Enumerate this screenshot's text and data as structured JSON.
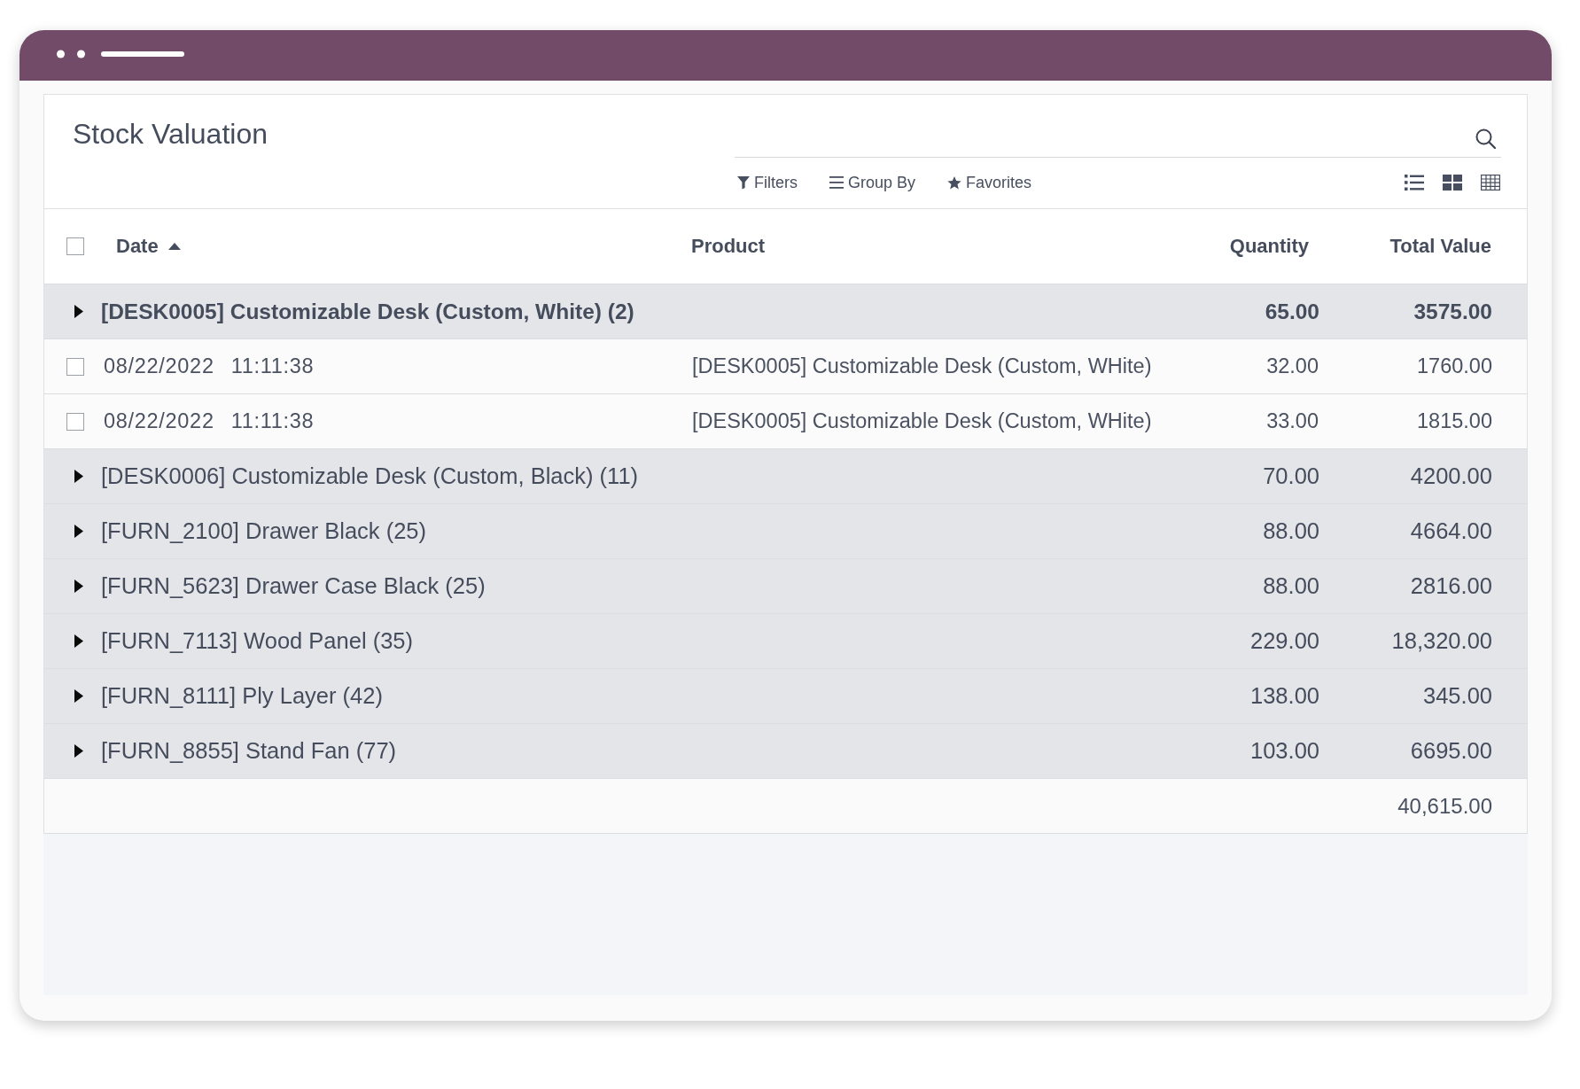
{
  "control_panel": {
    "title": "Stock Valuation",
    "search_menus": [
      {
        "kind": "filter",
        "label": "Filters"
      },
      {
        "kind": "group",
        "label": "Group By"
      },
      {
        "kind": "favorite",
        "label": "Favorites"
      }
    ],
    "views": [
      {
        "kind": "list"
      },
      {
        "kind": "kanban"
      },
      {
        "kind": "grid"
      }
    ]
  },
  "table": {
    "select_all": {
      "checked": false
    },
    "columns": [
      {
        "label": "Date",
        "kind": "date",
        "sorted": true
      },
      {
        "label": "Product",
        "kind": "text",
        "sorted": false
      },
      {
        "label": "Quantity",
        "kind": "number",
        "sorted": false
      },
      {
        "label": "Total Value",
        "kind": "number",
        "sorted": false
      }
    ],
    "groups": [
      {
        "label": "[DESK0005] Customizable Desk (Custom, White) (2)",
        "quantity": "65.00",
        "total_value": "3575.00",
        "expanded": true,
        "rows": [
          {
            "checked": false,
            "date": "08/22/2022 11:11:38",
            "product": "[DESK0005] Customizable Desk (Custom, WHite)",
            "quantity": "32.00",
            "total_value": "1760.00"
          },
          {
            "checked": false,
            "date": "08/22/2022 11:11:38",
            "product": "[DESK0005] Customizable Desk (Custom, WHite)",
            "quantity": "33.00",
            "total_value": "1815.00"
          }
        ]
      },
      {
        "label": "[DESK0006] Customizable Desk (Custom, Black) (11)",
        "quantity": "70.00",
        "total_value": "4200.00",
        "expanded": false
      },
      {
        "label": "[FURN_2100] Drawer Black (25)",
        "quantity": "88.00",
        "total_value": "4664.00",
        "expanded": false
      },
      {
        "label": "[FURN_5623] Drawer Case Black (25)",
        "quantity": "88.00",
        "total_value": "2816.00",
        "expanded": false
      },
      {
        "label": "[FURN_7113] Wood Panel (35)",
        "quantity": "229.00",
        "total_value": "18,320.00",
        "expanded": false
      },
      {
        "label": "[FURN_8111] Ply Layer (42)",
        "quantity": "138.00",
        "total_value": "345.00",
        "expanded": false
      },
      {
        "label": "[FURN_8855] Stand Fan (77)",
        "quantity": "103.00",
        "total_value": "6695.00",
        "expanded": false
      }
    ],
    "totals": {
      "total_value": "40,615.00"
    }
  }
}
